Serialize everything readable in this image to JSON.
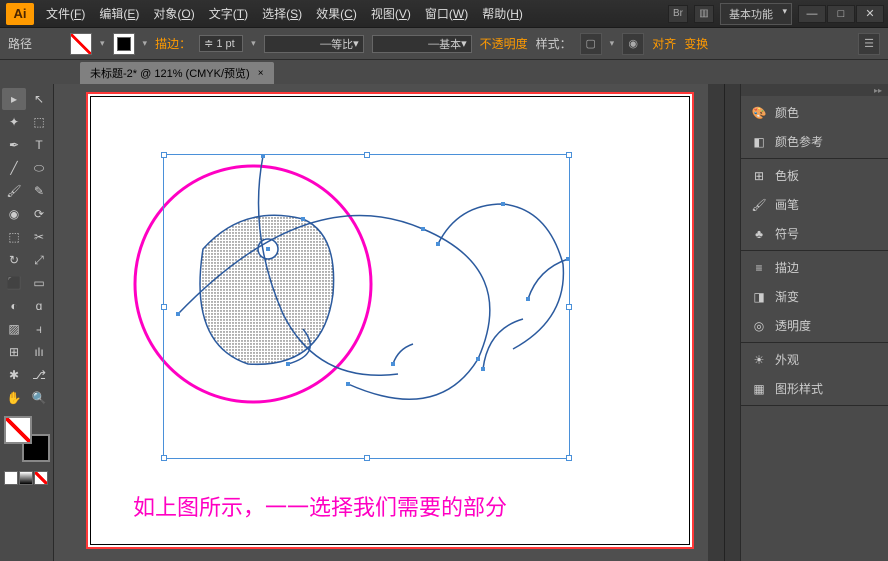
{
  "app": {
    "logo": "Ai"
  },
  "menu": [
    {
      "label": "文件",
      "key": "F"
    },
    {
      "label": "编辑",
      "key": "E"
    },
    {
      "label": "对象",
      "key": "O"
    },
    {
      "label": "文字",
      "key": "T"
    },
    {
      "label": "选择",
      "key": "S"
    },
    {
      "label": "效果",
      "key": "C"
    },
    {
      "label": "视图",
      "key": "V"
    },
    {
      "label": "窗口",
      "key": "W"
    },
    {
      "label": "帮助",
      "key": "H"
    }
  ],
  "workspace": "基本功能",
  "window": {
    "min": "—",
    "max": "□",
    "close": "✕"
  },
  "control": {
    "context": "路径",
    "stroke_label": "描边：",
    "stroke_pt": "1 pt",
    "uniform": "等比",
    "basic": "基本",
    "opacity": "不透明度",
    "style": "样式：",
    "align": "对齐",
    "transform": "变换"
  },
  "doc": {
    "title": "未标题-2* @ 121% (CMYK/预览)",
    "close": "×"
  },
  "caption": "如上图所示，一一选择我们需要的部分",
  "panels": [
    {
      "group": [
        {
          "icon": "🎨",
          "label": "颜色"
        },
        {
          "icon": "◧",
          "label": "颜色参考"
        }
      ]
    },
    {
      "group": [
        {
          "icon": "⊞",
          "label": "色板"
        },
        {
          "icon": "🖌",
          "label": "画笔"
        },
        {
          "icon": "♣",
          "label": "符号"
        }
      ]
    },
    {
      "group": [
        {
          "icon": "≡",
          "label": "描边"
        },
        {
          "icon": "◨",
          "label": "渐变"
        },
        {
          "icon": "◎",
          "label": "透明度"
        }
      ]
    },
    {
      "group": [
        {
          "icon": "☀",
          "label": "外观"
        },
        {
          "icon": "▦",
          "label": "图形样式"
        }
      ]
    }
  ],
  "tools": [
    [
      "▸",
      "↖"
    ],
    [
      "✦",
      "⬚"
    ],
    [
      "✒",
      "T"
    ],
    [
      "╱",
      "⬭"
    ],
    [
      "🖌",
      "✎"
    ],
    [
      "◉",
      "⟳"
    ],
    [
      "⬚",
      "✂"
    ],
    [
      "↻",
      "⤢"
    ],
    [
      "⬛",
      "▭"
    ],
    [
      "◐",
      "ɑ"
    ],
    [
      "▨",
      "⫞"
    ],
    [
      "⊞",
      "ılı"
    ],
    [
      "✱",
      "⎇"
    ],
    [
      "✋",
      "🔍"
    ]
  ],
  "modes": [
    "□",
    "■",
    "▨"
  ]
}
